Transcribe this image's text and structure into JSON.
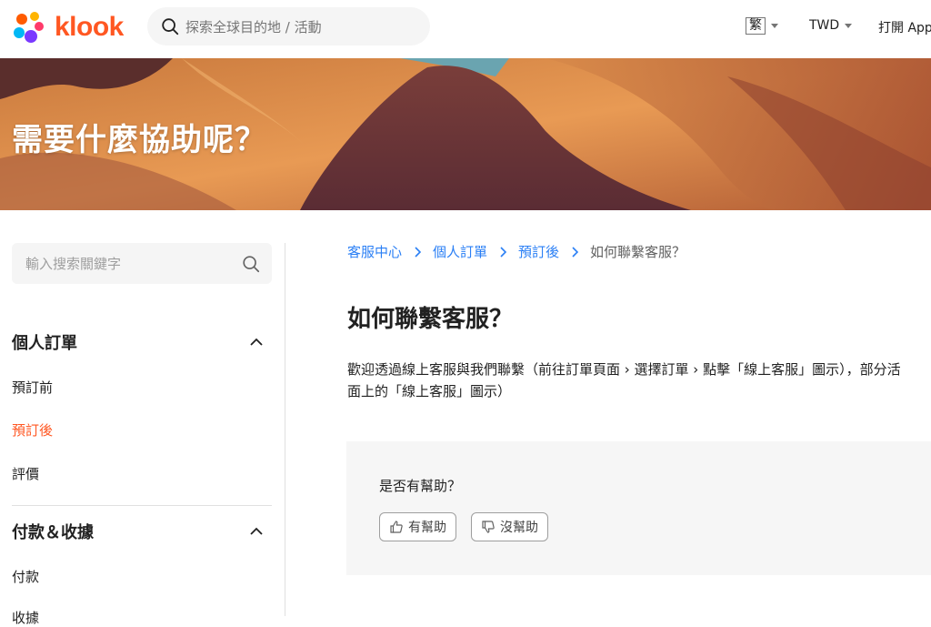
{
  "header": {
    "logo_text": "klook",
    "search_placeholder": "探索全球目的地 / 活動",
    "language": "繁",
    "currency": "TWD",
    "open_app": "打開 App"
  },
  "banner": {
    "title": "需要什麼協助呢？"
  },
  "sidebar": {
    "search_placeholder": "輸入搜索關鍵字",
    "sections": [
      {
        "title": "個人訂單",
        "expanded": true,
        "items": [
          {
            "label": "預訂前",
            "active": false
          },
          {
            "label": "預訂後",
            "active": true
          },
          {
            "label": "評價",
            "active": false
          }
        ]
      },
      {
        "title": "付款＆收據",
        "expanded": true,
        "items": [
          {
            "label": "付款",
            "active": false
          },
          {
            "label": "收據",
            "active": false
          }
        ]
      }
    ]
  },
  "breadcrumb": {
    "items": [
      "客服中心",
      "個人訂單",
      "預訂後"
    ],
    "current": "如何聯繫客服？"
  },
  "article": {
    "title": "如何聯繫客服？",
    "line1": "歡迎透過線上客服與我們聯繫（前往訂單頁面 › 選擇訂單 › 點擊「線上客服」圖示），部分活",
    "line2": "面上的「線上客服」圖示）"
  },
  "feedback": {
    "question": "是否有幫助？",
    "yes_label": "有幫助",
    "no_label": "沒幫助"
  },
  "colors": {
    "brand": "#ff5722",
    "link": "#2a7ff5",
    "active": "#ff5722"
  }
}
